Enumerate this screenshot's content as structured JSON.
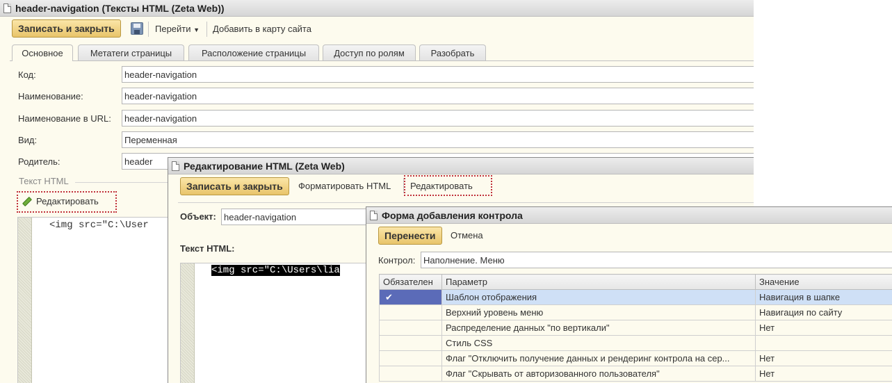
{
  "win1": {
    "title": "header-navigation (Тексты HTML (Zeta Web))",
    "toolbar": {
      "save_close": "Записать и закрыть",
      "goto": "Перейти",
      "add_sitemap": "Добавить в карту сайта"
    },
    "tabs": [
      "Основное",
      "Метатеги страницы",
      "Расположение страницы",
      "Доступ по ролям",
      "Разобрать"
    ],
    "fields": {
      "code": {
        "label": "Код:",
        "value": "header-navigation"
      },
      "name": {
        "label": "Наименование:",
        "value": "header-navigation"
      },
      "url_name": {
        "label": "Наименование в URL:",
        "value": "header-navigation"
      },
      "kind": {
        "label": "Вид:",
        "value": "Переменная"
      },
      "parent": {
        "label": "Родитель:",
        "value": "header"
      }
    },
    "html_group": "Текст HTML",
    "edit_button": "Редактировать",
    "code_line": "<img src=\"C:\\User"
  },
  "win2": {
    "title": "Редактирование HTML (Zeta Web)",
    "toolbar": {
      "save_close": "Записать и закрыть",
      "format": "Форматировать HTML",
      "edit": "Редактировать"
    },
    "object_label": "Объект:",
    "object_value": "header-navigation",
    "html_label": "Текст HTML:",
    "code_line": "<img src=\"C:\\Users\\lia"
  },
  "win3": {
    "title": "Форма добавления контрола",
    "toolbar": {
      "transfer": "Перенести",
      "cancel": "Отмена"
    },
    "control_label": "Контрол:",
    "control_value": "Наполнение. Меню",
    "columns": [
      "Обязателен",
      "Параметр",
      "Значение"
    ],
    "rows": [
      {
        "required": "✔",
        "param": "Шаблон отображения",
        "value": "Навигация в шапке"
      },
      {
        "required": "",
        "param": "Верхний уровень меню",
        "value": "Навигация по сайту"
      },
      {
        "required": "",
        "param": "Распределение данных \"по вертикали\"",
        "value": "Нет"
      },
      {
        "required": "",
        "param": "Стиль CSS",
        "value": ""
      },
      {
        "required": "",
        "param": "Флаг \"Отключить получение данных и рендеринг контрола на сер...",
        "value": "Нет"
      },
      {
        "required": "",
        "param": "Флаг \"Скрывать от авторизованного пользователя\"",
        "value": "Нет"
      }
    ]
  },
  "colors": {
    "accent_button": "#e8c46a",
    "selection": "#cfe0f6",
    "required_marker": "#5b6bb8",
    "highlight_border": "#c0303a",
    "form_background": "#fdfbee"
  }
}
